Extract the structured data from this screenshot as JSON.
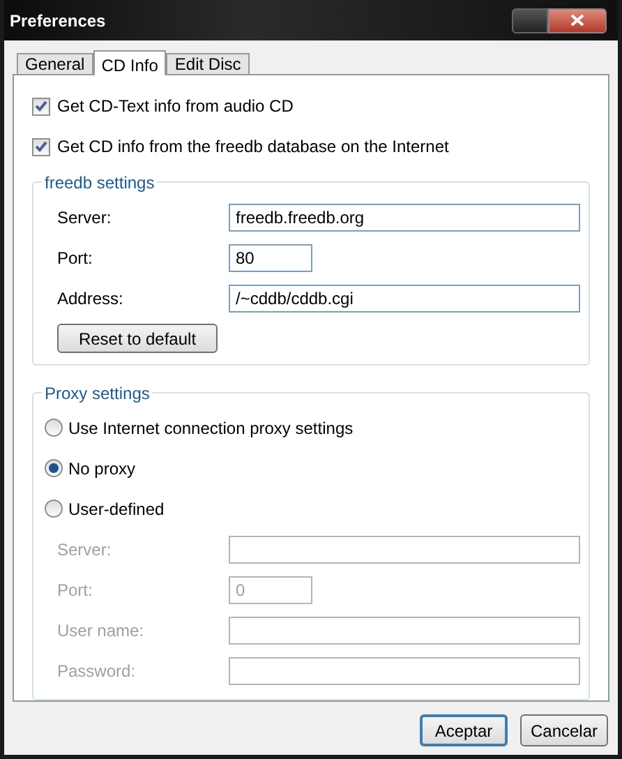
{
  "window": {
    "title": "Preferences"
  },
  "tabs": [
    {
      "label": "General",
      "selected": false
    },
    {
      "label": "CD Info",
      "selected": true
    },
    {
      "label": "Edit Disc",
      "selected": false
    }
  ],
  "options": [
    {
      "label": "Get CD-Text info from audio CD",
      "checked": true
    },
    {
      "label": "Get CD info from the freedb database on the Internet",
      "checked": true
    }
  ],
  "freedb_settings": {
    "title": "freedb settings",
    "fields": [
      {
        "label": "Server:",
        "value": "freedb.freedb.org",
        "kind": "wide",
        "disabled": false
      },
      {
        "label": "Port:",
        "value": "80",
        "kind": "short",
        "disabled": false
      },
      {
        "label": "Address:",
        "value": "/~cddb/cddb.cgi",
        "kind": "wide",
        "disabled": false
      }
    ],
    "reset_button": "Reset to default"
  },
  "proxy_settings": {
    "title": "Proxy settings",
    "radios": [
      {
        "label": "Use Internet connection proxy settings",
        "selected": false
      },
      {
        "label": "No proxy",
        "selected": true
      },
      {
        "label": "User-defined",
        "selected": false
      }
    ],
    "fields": [
      {
        "label": "Server:",
        "kind": "wide",
        "disabled": true
      },
      {
        "label": "Port:",
        "value": "0",
        "kind": "short",
        "disabled": true
      },
      {
        "label": "User name:",
        "kind": "wide",
        "disabled": true
      },
      {
        "label": "Password:",
        "kind": "wide",
        "disabled": true
      }
    ]
  },
  "buttons": [
    {
      "label": "Aceptar",
      "default": true
    },
    {
      "label": "Cancelar",
      "default": false
    }
  ]
}
